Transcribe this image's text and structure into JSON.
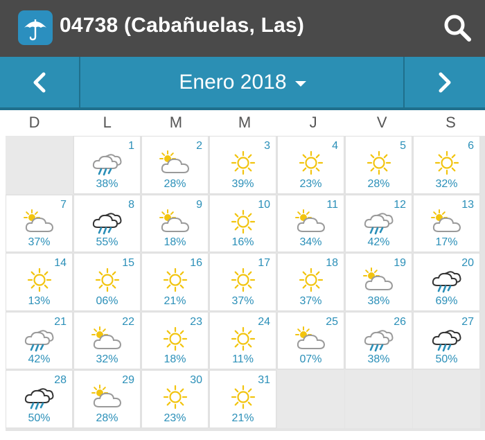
{
  "header": {
    "title": "04738 (Cabañuelas, Las)",
    "app_icon": "umbrella-icon",
    "search_icon": "search-icon",
    "bg_color": "#4a4a4a"
  },
  "month_nav": {
    "label": "Enero 2018",
    "prev_icon": "chevron-left-icon",
    "next_icon": "chevron-right-icon",
    "accent": "#2b8fb4"
  },
  "weekdays": [
    "D",
    "L",
    "M",
    "M",
    "J",
    "V",
    "S"
  ],
  "days": [
    {
      "day": "1",
      "pct": "38%",
      "icon": "rain-cloud-light"
    },
    {
      "day": "2",
      "pct": "28%",
      "icon": "partly-cloudy"
    },
    {
      "day": "3",
      "pct": "39%",
      "icon": "sun"
    },
    {
      "day": "4",
      "pct": "23%",
      "icon": "sun"
    },
    {
      "day": "5",
      "pct": "28%",
      "icon": "sun"
    },
    {
      "day": "6",
      "pct": "32%",
      "icon": "sun"
    },
    {
      "day": "7",
      "pct": "37%",
      "icon": "partly-cloudy"
    },
    {
      "day": "8",
      "pct": "55%",
      "icon": "rain-cloud-dark"
    },
    {
      "day": "9",
      "pct": "18%",
      "icon": "partly-cloudy"
    },
    {
      "day": "10",
      "pct": "16%",
      "icon": "sun"
    },
    {
      "day": "11",
      "pct": "34%",
      "icon": "partly-cloudy"
    },
    {
      "day": "12",
      "pct": "42%",
      "icon": "rain-cloud-light"
    },
    {
      "day": "13",
      "pct": "17%",
      "icon": "partly-cloudy"
    },
    {
      "day": "14",
      "pct": "13%",
      "icon": "sun"
    },
    {
      "day": "15",
      "pct": "06%",
      "icon": "sun"
    },
    {
      "day": "16",
      "pct": "21%",
      "icon": "sun"
    },
    {
      "day": "17",
      "pct": "37%",
      "icon": "sun"
    },
    {
      "day": "18",
      "pct": "37%",
      "icon": "sun"
    },
    {
      "day": "19",
      "pct": "38%",
      "icon": "partly-cloudy"
    },
    {
      "day": "20",
      "pct": "69%",
      "icon": "rain-cloud-dark"
    },
    {
      "day": "21",
      "pct": "42%",
      "icon": "rain-cloud-light"
    },
    {
      "day": "22",
      "pct": "32%",
      "icon": "partly-cloudy"
    },
    {
      "day": "23",
      "pct": "18%",
      "icon": "sun"
    },
    {
      "day": "24",
      "pct": "11%",
      "icon": "sun"
    },
    {
      "day": "25",
      "pct": "07%",
      "icon": "partly-cloudy"
    },
    {
      "day": "26",
      "pct": "38%",
      "icon": "rain-cloud-light"
    },
    {
      "day": "27",
      "pct": "50%",
      "icon": "rain-cloud-dark"
    },
    {
      "day": "28",
      "pct": "50%",
      "icon": "rain-cloud-dark"
    },
    {
      "day": "29",
      "pct": "28%",
      "icon": "partly-cloudy"
    },
    {
      "day": "30",
      "pct": "23%",
      "icon": "sun"
    },
    {
      "day": "31",
      "pct": "21%",
      "icon": "sun"
    }
  ],
  "colors": {
    "sun": "#f2c40f",
    "rain": "#2a8fb8",
    "cloud_light": "#9a9a9a",
    "cloud_dark": "#333333",
    "text_accent": "#2a8fb8"
  }
}
